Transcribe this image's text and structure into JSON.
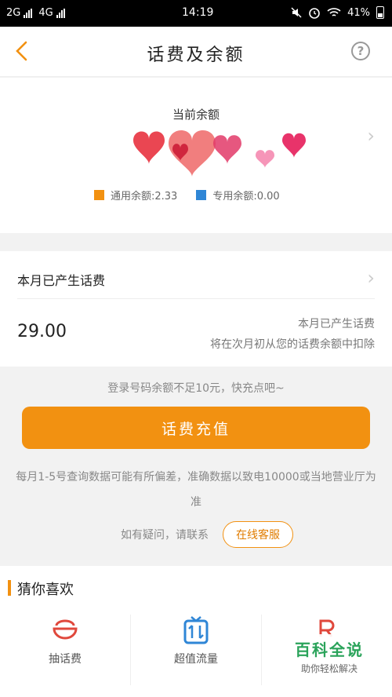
{
  "status_bar": {
    "carrier1": "2G",
    "carrier2": "4G",
    "time": "14:19",
    "battery": "41%"
  },
  "nav": {
    "title": "话费及余额",
    "back_icon": "chevron-left-icon",
    "help_icon": "question-circle-icon"
  },
  "balance": {
    "label": "当前余额",
    "general_label": "通用余额:2.33",
    "special_label": "专用余额:0.00",
    "colors": {
      "general": "#f29111",
      "special": "#2f86d6"
    }
  },
  "usage": {
    "title": "本月已产生话费",
    "amount": "29.00",
    "note_line1": "本月已产生话费",
    "note_line2": "将在次月初从您的话费余额中扣除"
  },
  "warning": "登录号码余额不足10元，快充点吧~",
  "recharge_button": "话费充值",
  "disclaimer": "每月1-5号查询数据可能有所偏差，准确数据以致电10000或当地营业厅为准",
  "contact": {
    "question": "如有疑问，请联系",
    "service_button": "在线客服"
  },
  "recommend": {
    "title": "猜你喜欢",
    "items": [
      {
        "label": "抽话费",
        "icon": "gift-bowl-icon"
      },
      {
        "label": "超值流量",
        "icon": "data-transfer-icon"
      }
    ]
  },
  "watermark": {
    "main": "百科全说",
    "sub": "助你轻松解决"
  },
  "accent_color": "#f29111"
}
